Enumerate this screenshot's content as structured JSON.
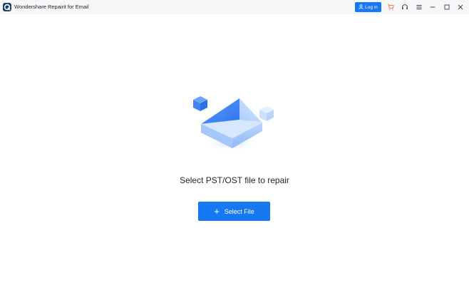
{
  "titlebar": {
    "app_title": "Wondershare Repairit for Email",
    "login_label": "Log in",
    "icons": [
      "app-logo-icon",
      "user-icon",
      "cart-icon",
      "headset-icon",
      "menu-icon",
      "minimize-icon",
      "maximize-icon",
      "close-icon"
    ]
  },
  "main": {
    "prompt": "Select PST/OST file to repair",
    "select_file_label": "Select File",
    "illustration": "envelope-illustration"
  },
  "colors": {
    "accent": "#1877f2",
    "cart": "#f26d4f",
    "titlebar_bg": "#f6f7f9"
  }
}
